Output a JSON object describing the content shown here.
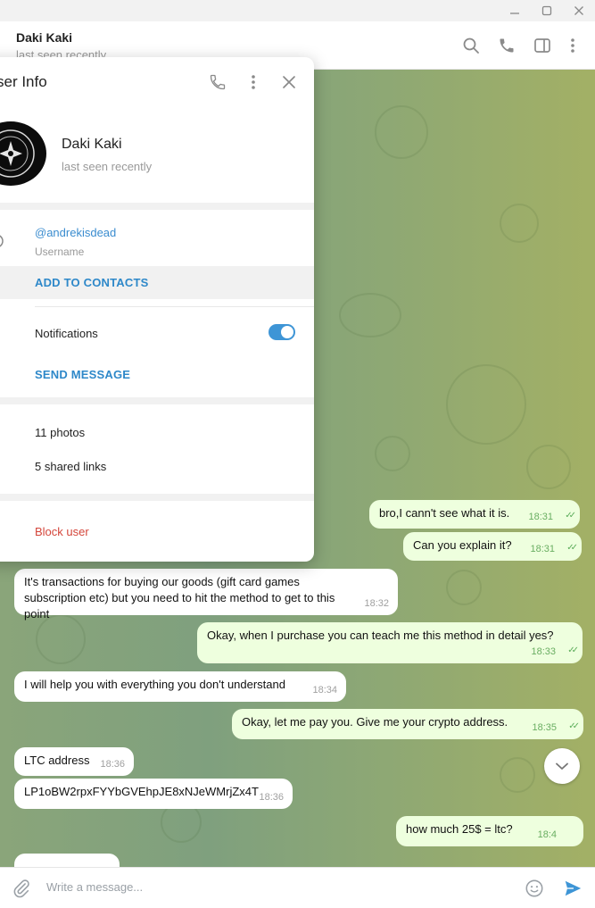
{
  "chat": {
    "peer_name": "Daki Kaki",
    "peer_status": "last seen recently",
    "composer_placeholder": "Write a message...",
    "messages": [
      {
        "dir": "out",
        "text": "bro,I cann't see what it is.",
        "time": "18:31"
      },
      {
        "dir": "out",
        "text": "Can you explain it?",
        "time": "18:31"
      },
      {
        "dir": "in",
        "text": "It's transactions for buying our goods (gift card games subscription etc) but you need to hit the method to get to this point",
        "time": "18:32"
      },
      {
        "dir": "out",
        "text": "Okay, when I purchase you can teach me this method in detail yes?",
        "time": "18:33"
      },
      {
        "dir": "in",
        "text": "I will help you with everything you don't understand",
        "time": "18:34"
      },
      {
        "dir": "out",
        "text": "Okay, let me pay you. Give me your crypto address.",
        "time": "18:35"
      },
      {
        "dir": "in",
        "text": "LTC address",
        "time": "18:36"
      },
      {
        "dir": "in",
        "text": "LP1oBW2rpxFYYbGVEhpJE8xNJeWMrjZx4T",
        "time": "18:36"
      },
      {
        "dir": "out",
        "text": "how much 25$ = ltc?",
        "time": "18:4"
      }
    ]
  },
  "user_info": {
    "title": "ser Info",
    "name": "Daki Kaki",
    "status": "last seen recently",
    "username": "@andrekisdead",
    "username_label": "Username",
    "add_to_contacts": "ADD TO CONTACTS",
    "notifications_label": "Notifications",
    "notifications_on": true,
    "send_message": "SEND MESSAGE",
    "photos": "11 photos",
    "shared_links": "5 shared links",
    "block_user": "Block user"
  },
  "colors": {
    "accent": "#3e95d6",
    "link": "#2e88c9",
    "danger": "#d4463b",
    "bubble_out": "#eeffde",
    "bubble_in": "#ffffff"
  },
  "icons": {
    "titlebar": [
      "minimize-icon",
      "maximize-icon",
      "close-icon"
    ],
    "header": [
      "search-icon",
      "phone-icon",
      "sidebar-toggle-icon",
      "more-vertical-icon"
    ],
    "composer": [
      "attach-icon",
      "emoji-icon",
      "send-icon"
    ],
    "panel": [
      "phone-icon",
      "more-vertical-icon",
      "close-icon"
    ]
  }
}
